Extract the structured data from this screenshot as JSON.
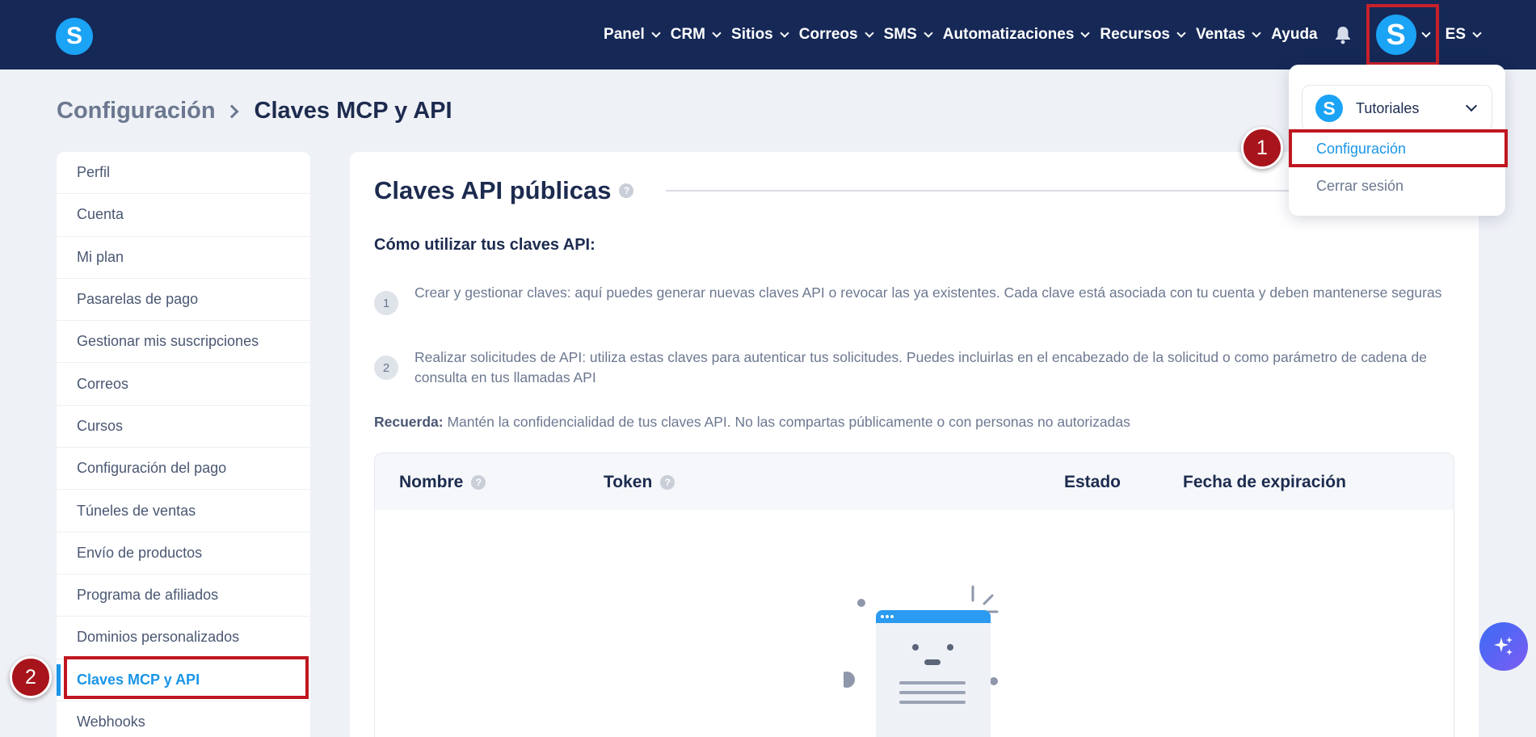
{
  "nav": {
    "logo_letter": "S",
    "items": [
      {
        "label": "Panel",
        "has_menu": true
      },
      {
        "label": "CRM",
        "has_menu": true
      },
      {
        "label": "Sitios",
        "has_menu": true
      },
      {
        "label": "Correos",
        "has_menu": true
      },
      {
        "label": "SMS",
        "has_menu": true
      },
      {
        "label": "Automatizaciones",
        "has_menu": true
      },
      {
        "label": "Recursos",
        "has_menu": true
      },
      {
        "label": "Ventas",
        "has_menu": true
      },
      {
        "label": "Ayuda",
        "has_menu": false
      }
    ],
    "notifications_icon": "bell-icon",
    "avatar_letter": "S",
    "language": "ES"
  },
  "breadcrumb": {
    "root": "Configuración",
    "current": "Claves MCP y API"
  },
  "sidebar": {
    "items": [
      {
        "label": "Perfil"
      },
      {
        "label": "Cuenta"
      },
      {
        "label": "Mi plan"
      },
      {
        "label": "Pasarelas de pago"
      },
      {
        "label": "Gestionar mis suscripciones"
      },
      {
        "label": "Correos"
      },
      {
        "label": "Cursos"
      },
      {
        "label": "Configuración del pago"
      },
      {
        "label": "Túneles de ventas"
      },
      {
        "label": "Envío de productos"
      },
      {
        "label": "Programa de afiliados"
      },
      {
        "label": "Dominios personalizados"
      },
      {
        "label": "Claves MCP y API",
        "active": true
      },
      {
        "label": "Webhooks"
      }
    ]
  },
  "main": {
    "title": "Claves API públicas",
    "how_to": "Cómo utilizar tus claves API:",
    "steps": [
      {
        "num": "1",
        "text": "Crear y gestionar claves: aquí puedes generar nuevas claves API o revocar las ya existentes. Cada clave está asociada con tu cuenta y deben mantenerse seguras"
      },
      {
        "num": "2",
        "text": "Realizar solicitudes de API: utiliza estas claves para autenticar tus solicitudes. Puedes incluirlas en el encabezado de la solicitud o como parámetro de cadena de consulta en tus llamadas API"
      }
    ],
    "remember_label": "Recuerda:",
    "remember_text": " Mantén la confidencialidad de tus claves API. No las compartas públicamente o con personas no autorizadas",
    "table": {
      "columns": [
        "Nombre",
        "Token",
        "Estado",
        "Fecha de expiración"
      ],
      "rows": []
    }
  },
  "dropdown": {
    "account_letter": "S",
    "account_name": "Tutoriales",
    "items": [
      "Configuración",
      "Cerrar sesión"
    ]
  },
  "annotations": {
    "step1": "1",
    "step2": "2"
  },
  "colors": {
    "nav_bg": "#152856",
    "brand": "#1ba3f5",
    "accent": "#1a96e8",
    "highlight": "#c0161f"
  }
}
